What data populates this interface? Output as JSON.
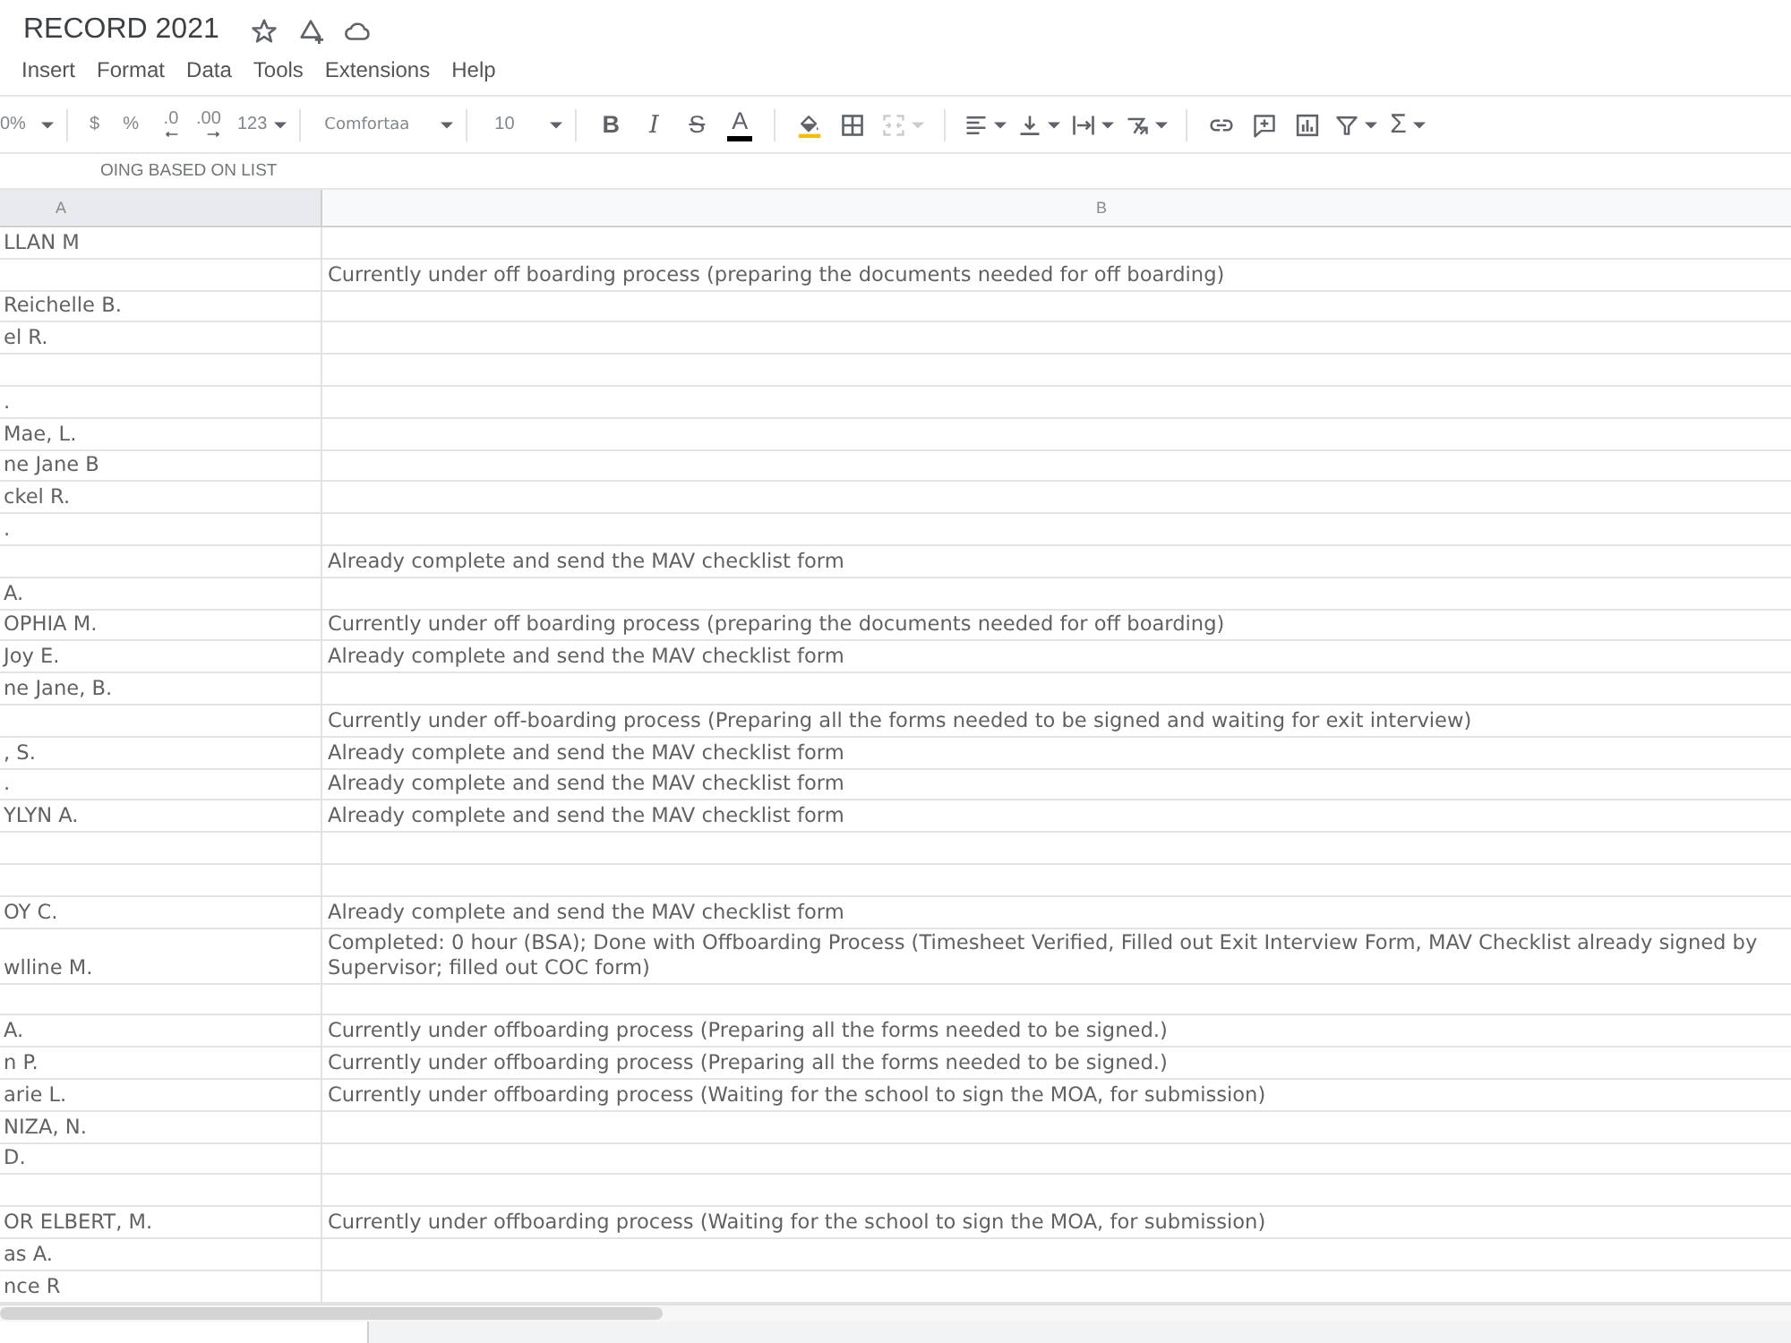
{
  "doc": {
    "title": "RECORD 2021"
  },
  "menu": [
    "Insert",
    "Format",
    "Data",
    "Tools",
    "Extensions",
    "Help"
  ],
  "toolbar": {
    "zoom": "0%",
    "currency": "$",
    "percent": "%",
    "decimal_decrease": ".0",
    "decimal_increase": ".00",
    "number_format": "123",
    "font": "Comfortaa",
    "font_size": "10",
    "bold": "B",
    "italic": "I",
    "strikethrough": "S",
    "text_color": "A",
    "merge": {
      "disabled": true
    },
    "functions": "Σ"
  },
  "formula_bar": {
    "value": "OING BASED ON LIST"
  },
  "columns": [
    {
      "label": "A",
      "selected": true
    },
    {
      "label": "B",
      "selected": false
    }
  ],
  "rows": [
    {
      "a": "LLAN M"
    },
    {
      "b": "Currently under off boarding process (preparing the documents needed for off boarding)"
    },
    {
      "a": "Reichelle B."
    },
    {
      "a": "el R."
    },
    {},
    {
      "a": "."
    },
    {
      "a": "Mae, L."
    },
    {
      "a": "ne Jane B"
    },
    {
      "a": "ckel R."
    },
    {
      "a": "."
    },
    {
      "b": "Already complete and send the MAV checklist form"
    },
    {
      "a": "A."
    },
    {
      "a": "OPHIA M.",
      "b": "Currently under off boarding process (preparing the documents needed for off boarding)"
    },
    {
      "a": "Joy E.",
      "b": "Already complete and send the MAV checklist form"
    },
    {
      "a": "ne Jane, B."
    },
    {
      "b": "Currently under off-boarding process (Preparing all the forms needed to be signed and waiting for exit interview)"
    },
    {
      "a": ", S.",
      "b": "Already complete and send the MAV checklist form"
    },
    {
      "a": ".",
      "b": "Already complete and send the MAV checklist form"
    },
    {
      "a": "YLYN A.",
      "b": "Already complete and send the MAV checklist form"
    },
    {},
    {},
    {
      "a": "OY C.",
      "b": "Already complete and send the MAV checklist form"
    },
    {
      "a": "wlline M.",
      "b": "Completed: 0 hour (BSA); Done with Offboarding Process (Timesheet Verified, Filled out Exit Interview Form, MAV Checklist already signed by Supervisor; filled out COC form)"
    },
    {},
    {
      "a": "A.",
      "b": "Currently under offboarding process (Preparing all the forms needed to be signed.)"
    },
    {
      "a": "n P.",
      "b": "Currently under offboarding process (Preparing all the forms needed to be signed.)"
    },
    {
      "a": "arie L.",
      "b": "Currently under offboarding process (Waiting for the school to sign the MOA, for submission)"
    },
    {
      "a": "NIZA, N."
    },
    {
      "a": "D."
    },
    {},
    {
      "a": "OR ELBERT, M.",
      "b": "Currently under offboarding process (Waiting for the school to sign the MOA, for submission)"
    },
    {
      "a": "as A."
    },
    {
      "a": "nce R"
    }
  ]
}
